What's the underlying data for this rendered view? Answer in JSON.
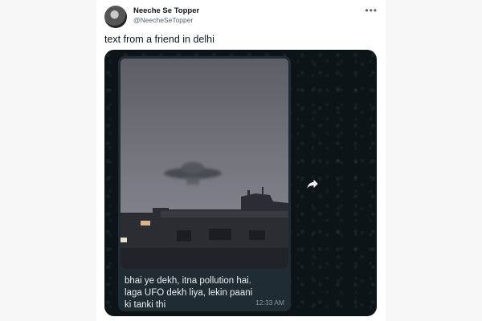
{
  "tweet": {
    "author_name": "Neeche Se Topper",
    "author_handle": "@NeecheSeTopper",
    "more_icon": "more-horizontal-icon",
    "text": "text from a friend in delhi"
  },
  "chat": {
    "message_text": "bhai ye dekh, itna pollution hai.\nlaga UFO dekh liya, lekin paani\nki tanki thi",
    "timestamp": "12:33 AM",
    "forward_icon": "forward-arrow-icon",
    "colors": {
      "chat_background": "#0d1418",
      "bubble": "#1f2c34",
      "message_text": "#e9edef",
      "timestamp": "#8696a0"
    }
  }
}
